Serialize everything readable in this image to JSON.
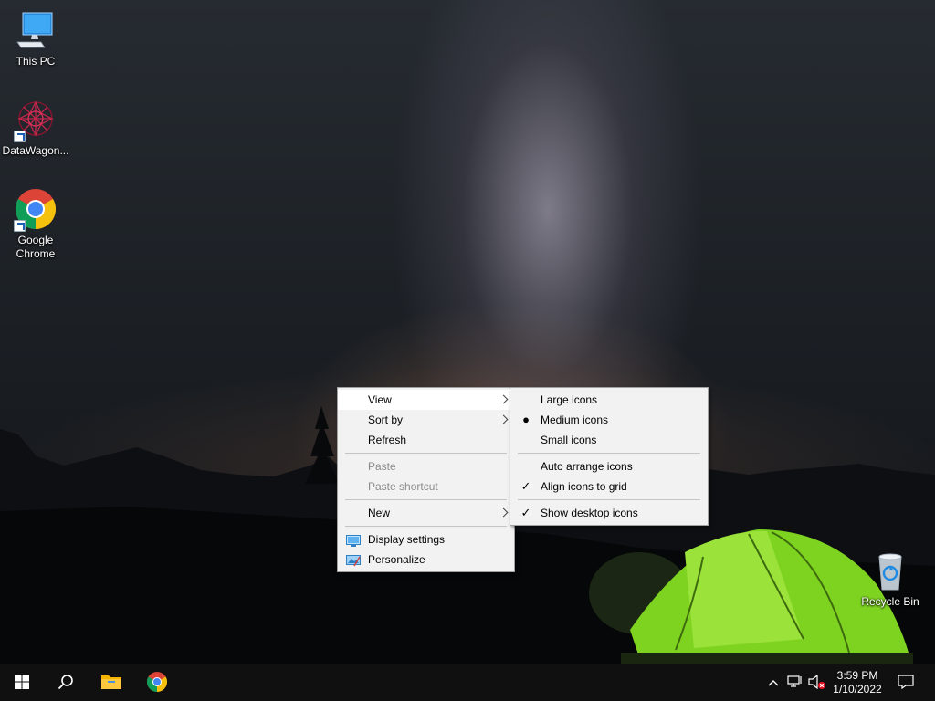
{
  "desktop": {
    "icons": [
      {
        "label": "This PC",
        "icon": "computer-icon"
      },
      {
        "label": "DataWagon...",
        "icon": "datawagon-icon"
      },
      {
        "label": "Google Chrome",
        "icon": "chrome-icon"
      },
      {
        "label": "Recycle Bin",
        "icon": "recycle-bin-icon"
      }
    ]
  },
  "context_menu": {
    "items": {
      "view": "View",
      "sort_by": "Sort by",
      "refresh": "Refresh",
      "paste": "Paste",
      "paste_shortcut": "Paste shortcut",
      "new": "New",
      "display_settings": "Display settings",
      "personalize": "Personalize"
    }
  },
  "view_submenu": {
    "items": {
      "large_icons": "Large icons",
      "medium_icons": "Medium icons",
      "small_icons": "Small icons",
      "auto_arrange": "Auto arrange icons",
      "align_grid": "Align icons to grid",
      "show_desktop_icons": "Show desktop icons"
    },
    "selected_size": "Medium icons",
    "checked": [
      "Align icons to grid",
      "Show desktop icons"
    ]
  },
  "taskbar": {
    "pinned": [
      "start-icon",
      "search-icon",
      "file-explorer-icon",
      "chrome-icon"
    ],
    "tray": [
      "chevron-up-icon",
      "network-icon",
      "volume-muted-icon"
    ],
    "time": "3:59 PM",
    "date": "1/10/2022",
    "notification": "notification-icon"
  },
  "colors": {
    "taskbar": "#101010",
    "menu_bg": "#f2f2f2",
    "menu_hover": "#ffffff",
    "disabled_text": "#8b8b8b"
  }
}
